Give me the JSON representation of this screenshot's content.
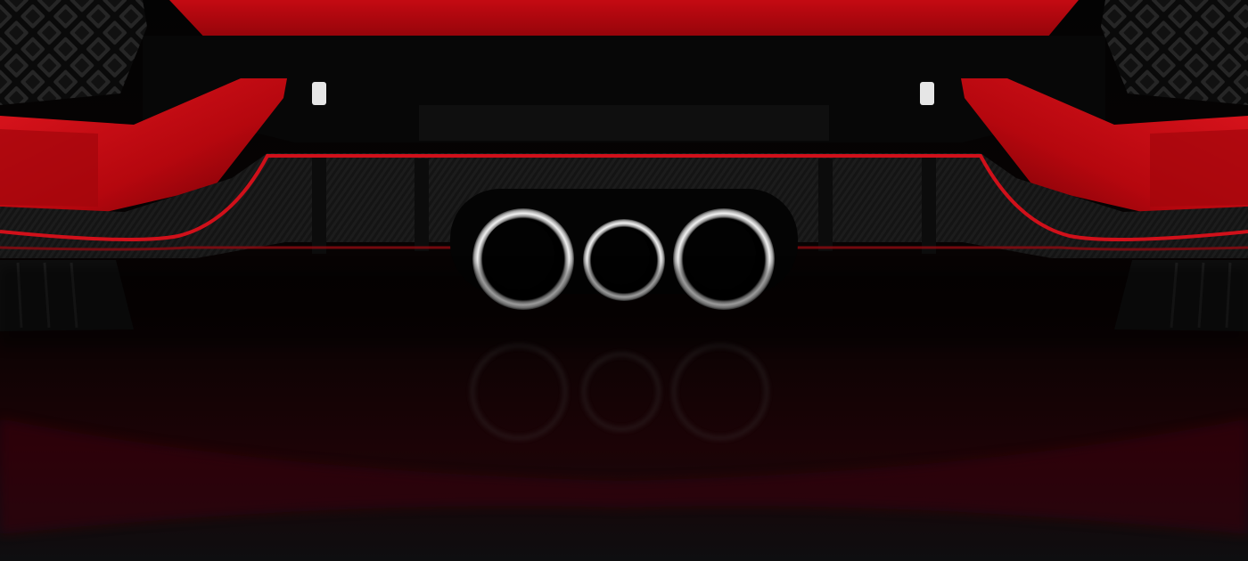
{
  "image": {
    "kind": "photo",
    "subject": "car-rear-diffuser-with-triple-exhaust",
    "colors": {
      "body_red": "#b8070f",
      "body_red_highlight": "#d7141c",
      "body_red_dark": "#6e0005",
      "black": "#050505",
      "carbon": "#161616",
      "chrome": "#d8d8d8",
      "floor_reflection": "#2a0508"
    },
    "exhaust_tip_count": 3
  }
}
